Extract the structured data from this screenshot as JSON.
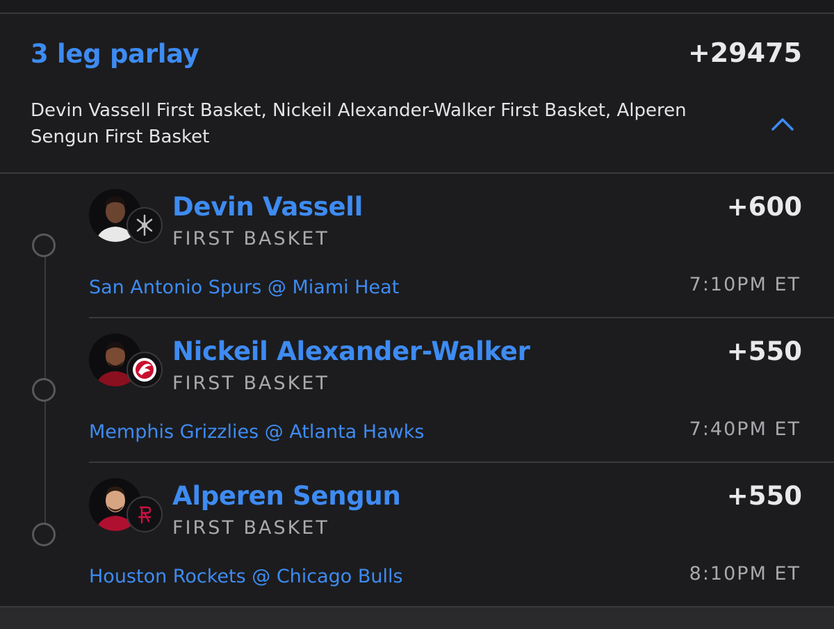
{
  "parlay": {
    "title": "3 leg parlay",
    "odds": "+29475",
    "summary": "Devin Vassell First Basket, Nickeil Alexander-Walker First Basket, Alperen Sengun First Basket",
    "collapse_icon": "chevron-up-icon"
  },
  "legs": [
    {
      "player": "Devin Vassell",
      "market": "FIRST BASKET",
      "odds": "+600",
      "matchup": "San Antonio Spurs @ Miami Heat",
      "time": "7:10PM ET",
      "team_icon": "spurs-logo-icon",
      "jersey_color": "#e8e8e8"
    },
    {
      "player": "Nickeil Alexander-Walker",
      "market": "FIRST BASKET",
      "odds": "+550",
      "matchup": "Memphis Grizzlies @ Atlanta Hawks",
      "time": "7:40PM ET",
      "team_icon": "hawks-logo-icon",
      "jersey_color": "#c8102e"
    },
    {
      "player": "Alperen Sengun",
      "market": "FIRST BASKET",
      "odds": "+550",
      "matchup": "Houston Rockets @ Chicago Bulls",
      "time": "8:10PM ET",
      "team_icon": "rockets-logo-icon",
      "jersey_color": "#ce1141"
    }
  ],
  "colors": {
    "accent": "#3e8bf2",
    "background": "#1c1c1e",
    "divider": "#3a3a3c",
    "muted_text": "#a9a9ad"
  }
}
